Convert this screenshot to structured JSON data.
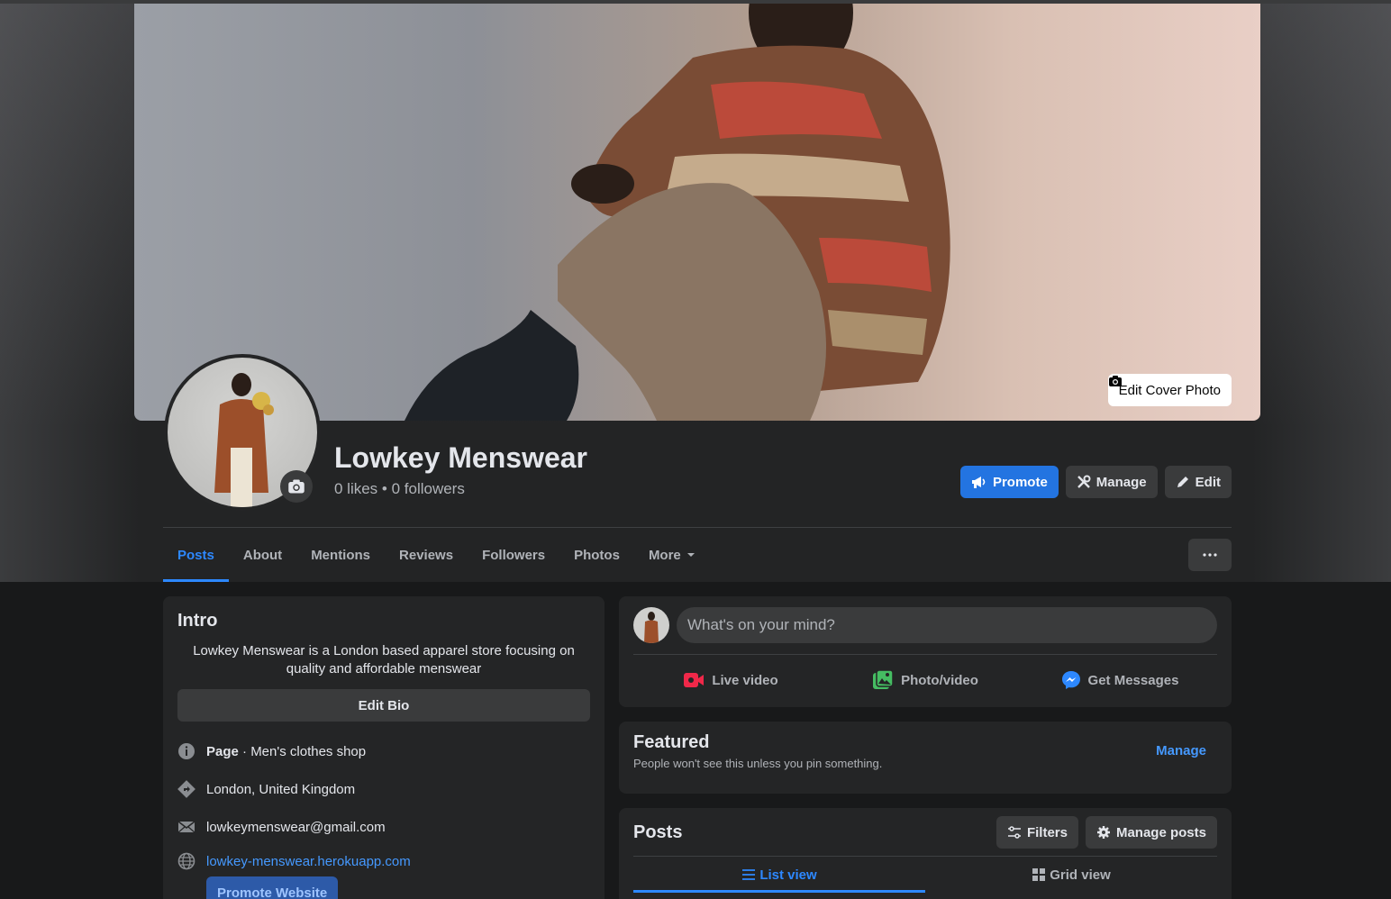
{
  "cover": {
    "edit_label": "Edit Cover Photo"
  },
  "page": {
    "name": "Lowkey Menswear",
    "stats": "0 likes • 0 followers"
  },
  "actions": {
    "promote": "Promote",
    "manage": "Manage",
    "edit": "Edit"
  },
  "tabs": [
    {
      "label": "Posts"
    },
    {
      "label": "About"
    },
    {
      "label": "Mentions"
    },
    {
      "label": "Reviews"
    },
    {
      "label": "Followers"
    },
    {
      "label": "Photos"
    },
    {
      "label": "More"
    }
  ],
  "intro": {
    "title": "Intro",
    "bio": "Lowkey Menswear is a London based apparel store focusing on quality and affordable menswear",
    "edit_bio": "Edit Bio",
    "category_bold": "Page",
    "category_rest": " · Men's clothes shop",
    "location": "London, United Kingdom",
    "email": "lowkeymenswear@gmail.com",
    "website": "lowkey-menswear.herokuapp.com",
    "promote_website": "Promote Website"
  },
  "composer": {
    "placeholder": "What's on your mind?",
    "live_video": "Live video",
    "photo_video": "Photo/video",
    "get_messages": "Get Messages"
  },
  "featured": {
    "title": "Featured",
    "subtitle": "People won't see this unless you pin something.",
    "manage": "Manage"
  },
  "posts": {
    "title": "Posts",
    "filters": "Filters",
    "manage_posts": "Manage posts",
    "list_view": "List view",
    "grid_view": "Grid view"
  },
  "colors": {
    "accent": "#2d88ff",
    "primary_button": "#2374e1",
    "card": "#242526",
    "page_bg": "#18191a"
  }
}
